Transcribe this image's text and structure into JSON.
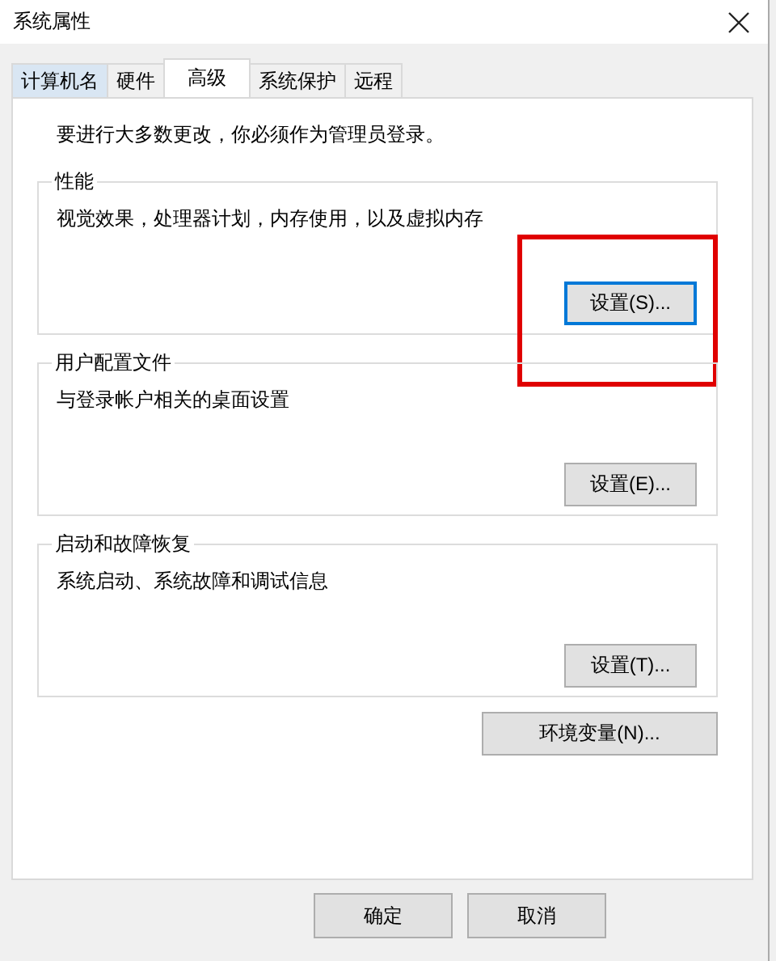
{
  "window": {
    "title": "系统属性"
  },
  "tabs": [
    {
      "label": "计算机名",
      "selected": false
    },
    {
      "label": "硬件",
      "selected": false
    },
    {
      "label": "高级",
      "selected": true
    },
    {
      "label": "系统保护",
      "selected": false
    },
    {
      "label": "远程",
      "selected": false
    }
  ],
  "notice": "要进行大多数更改，你必须作为管理员登录。",
  "groups": [
    {
      "title": "性能",
      "description": "视觉效果，处理器计划，内存使用，以及虚拟内存",
      "button": "设置(S)...",
      "focused": true,
      "highlighted": true
    },
    {
      "title": "用户配置文件",
      "description": "与登录帐户相关的桌面设置",
      "button": "设置(E)...",
      "focused": false,
      "highlighted": false
    },
    {
      "title": "启动和故障恢复",
      "description": "系统启动、系统故障和调试信息",
      "button": "设置(T)...",
      "focused": false,
      "highlighted": false
    }
  ],
  "env_button": "环境变量(N)...",
  "dialog_buttons": [
    "确定",
    "取消"
  ]
}
